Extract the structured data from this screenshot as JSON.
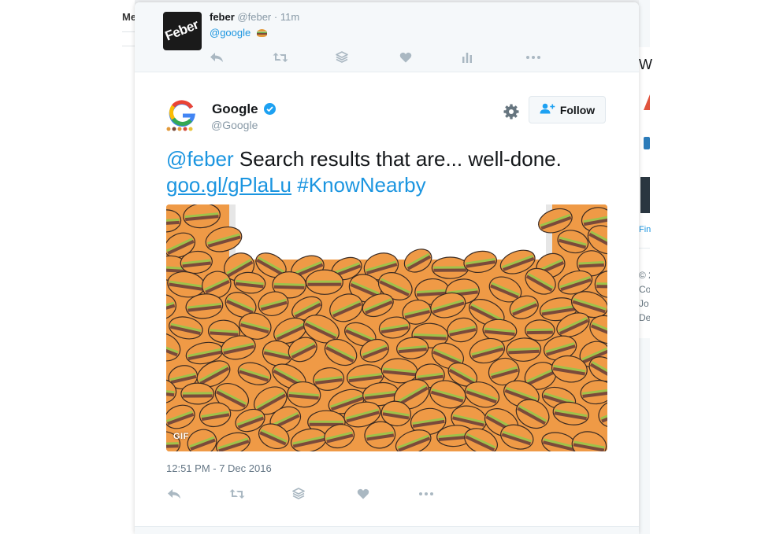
{
  "background": {
    "left_nav_label": "Me",
    "right_heading": "W",
    "right_link": "Fin",
    "right_footer": [
      "© 2",
      "Co",
      "Jo",
      "De"
    ]
  },
  "ancestor_tweet": {
    "author_name": "feber",
    "author_handle": "@feber",
    "separator": "·",
    "time": "11m",
    "avatar_text": "Feber",
    "mention": "@google",
    "emoji_icon": "hamburger-icon"
  },
  "tweet": {
    "author_name": "Google",
    "author_handle": "@Google",
    "verified_icon": "verified-badge-icon",
    "follow_label": "Follow",
    "text_mention": "@feber",
    "text_body": " Search results that are... well-done.",
    "text_url": "goo.gl/gPlaLu",
    "text_hashtag": "#KnowNearby",
    "media_badge": "GIF",
    "timestamp": "12:51 PM - 7 Dec 2016"
  },
  "actions": [
    "reply-icon",
    "retweet-icon",
    "stack-icon",
    "like-icon",
    "analytics-icon",
    "more-icon"
  ],
  "colors": {
    "link": "#1b95e0",
    "icon_gray": "#aab8c2",
    "verified": "#1da1f2",
    "burger_bun": "#ef9a46",
    "burger_patty": "#7a4a3a",
    "burger_lettuce": "#9ec24a"
  }
}
